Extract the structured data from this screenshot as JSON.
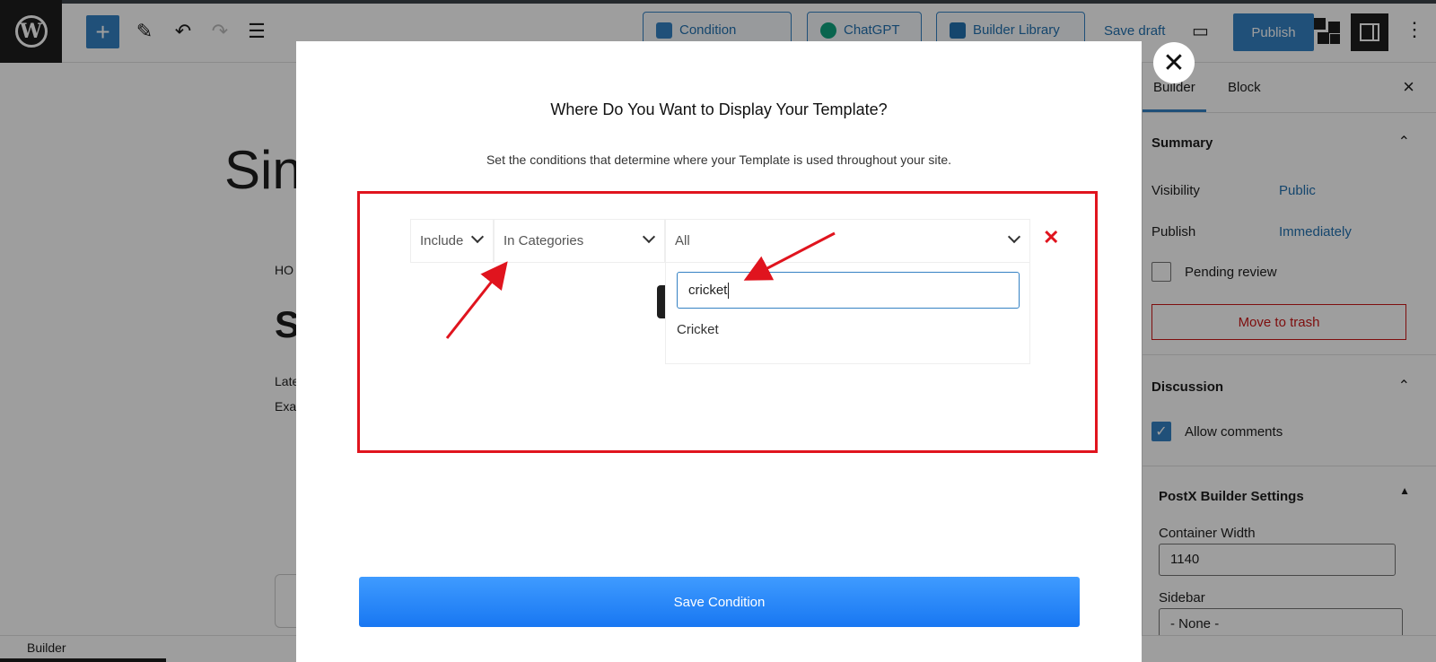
{
  "topbar": {
    "buttons": {
      "condition": "Condition",
      "chatgpt": "ChatGPT",
      "builder_library": "Builder Library",
      "save_draft": "Save draft",
      "publish": "Publish"
    },
    "icons": [
      "wordpress-logo",
      "add-block-icon",
      "edit-pencil-icon",
      "undo-icon",
      "redo-icon",
      "document-overview-icon",
      "desktop-view-icon",
      "blocks-icon",
      "settings-panel-icon",
      "more-options-icon"
    ]
  },
  "canvas": {
    "title_partial": "Sin",
    "breadcrumb_partial": "HO",
    "heading_partial": "S",
    "line1_partial": "Late",
    "line2_partial": "Exa"
  },
  "sidebar": {
    "tabs": [
      "Builder",
      "Block"
    ],
    "summary": {
      "title": "Summary",
      "visibility_label": "Visibility",
      "visibility_value": "Public",
      "publish_label": "Publish",
      "publish_value": "Immediately",
      "pending_label": "Pending review",
      "trash_label": "Move to trash"
    },
    "discussion": {
      "title": "Discussion",
      "allow_comments": "Allow comments"
    },
    "postx": {
      "title": "PostX Builder Settings",
      "container_width_label": "Container Width",
      "container_width_value": "1140",
      "sidebar_label": "Sidebar",
      "sidebar_value": "- None -"
    }
  },
  "statusbar": {
    "crumb": "Builder"
  },
  "modal": {
    "title": "Where Do You Want to Display Your Template?",
    "subtitle": "Set the conditions that determine where your Template is used throughout your site.",
    "condition": {
      "type": "Include",
      "rule": "In Categories",
      "target": "All"
    },
    "search": {
      "value": "cricket"
    },
    "options": [
      "Cricket"
    ],
    "save_label": "Save Condition"
  },
  "colors": {
    "accent": "#3582c4",
    "annotation_red": "#e0141e",
    "save_gradient_top": "#3f9bff",
    "save_gradient_bottom": "#1877f2"
  }
}
